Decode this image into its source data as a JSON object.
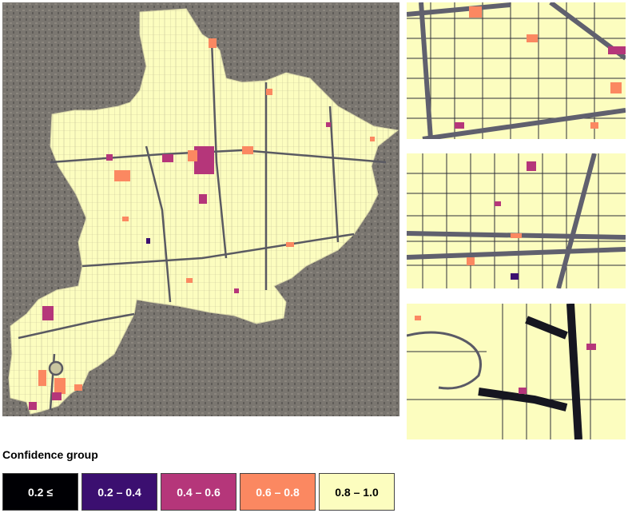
{
  "legend": {
    "title": "Confidence group",
    "items": [
      {
        "label": "0.2 ≤",
        "color": "#000004",
        "text_color": "#ffffff"
      },
      {
        "label": "0.2 – 0.4",
        "color": "#3b0f70",
        "text_color": "#ffffff"
      },
      {
        "label": "0.4 – 0.6",
        "color": "#b5367a",
        "text_color": "#ffffff"
      },
      {
        "label": "0.6 – 0.8",
        "color": "#fb8861",
        "text_color": "#ffffff"
      },
      {
        "label": "0.8 – 1.0",
        "color": "#fcfdbf",
        "text_color": "#000000"
      }
    ]
  },
  "map": {
    "background": "satellite imagery",
    "parcel_fill": "#fcfdbf",
    "road_color": "#4a4a55"
  }
}
